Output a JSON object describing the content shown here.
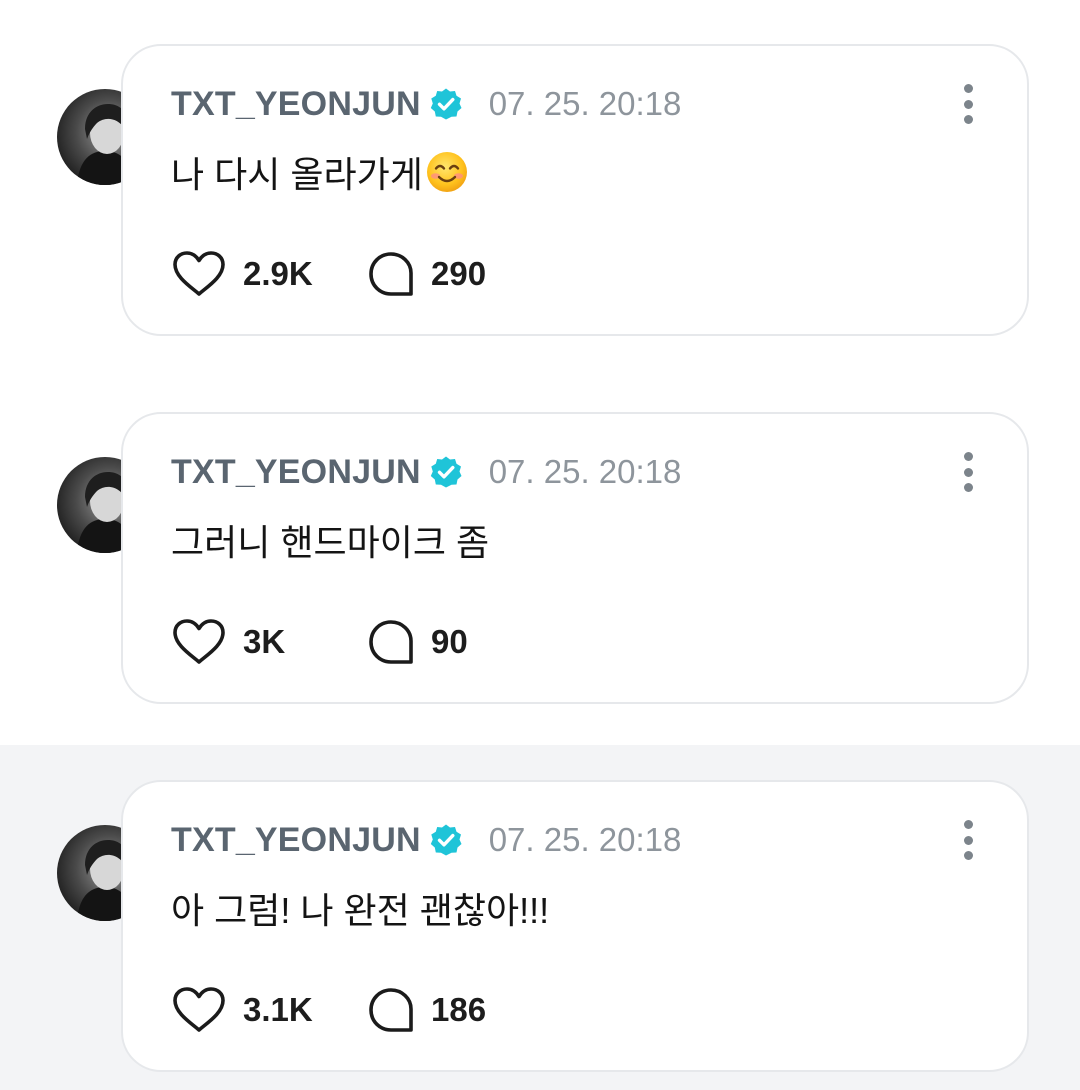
{
  "posts": [
    {
      "username": "TXT_YEONJUN",
      "timestamp": "07. 25. 20:18",
      "text": "나 다시 올라가게",
      "emoji": "smiling-face-with-smiling-eyes",
      "likes": "2.9K",
      "comments": "290"
    },
    {
      "username": "TXT_YEONJUN",
      "timestamp": "07. 25. 20:18",
      "text": "그러니 핸드마이크 좀",
      "likes": "3K",
      "comments": "90"
    },
    {
      "username": "TXT_YEONJUN",
      "timestamp": "07. 25. 20:18",
      "text": "아 그럼! 나 완전 괜찮아!!!",
      "likes": "3.1K",
      "comments": "186"
    }
  ],
  "icons": {
    "verified": "verified-badge-icon",
    "more": "more-vertical-icon",
    "like": "heart-icon",
    "comment": "comment-bubble-icon"
  },
  "colors": {
    "verified_badge": "#1fc4d8",
    "username": "#5a6570",
    "timestamp": "#8e959c",
    "card_border": "#e6e8eb",
    "highlight_background": "#f3f4f6"
  }
}
